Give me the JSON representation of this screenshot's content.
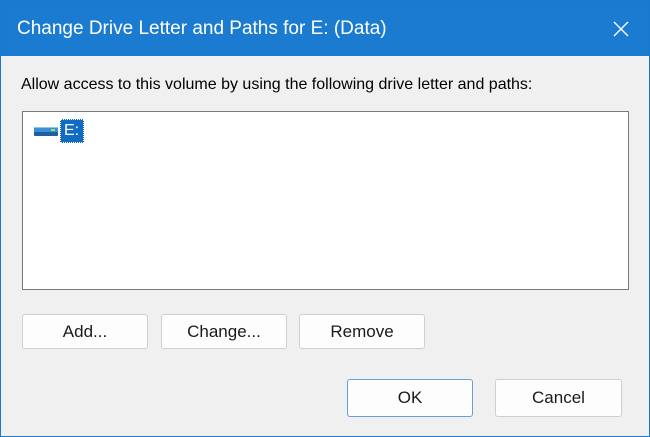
{
  "window": {
    "title": "Change Drive Letter and Paths for E: (Data)",
    "accent_color": "#1b7bd0"
  },
  "titlebar": {
    "close_icon": "close-icon"
  },
  "dialog": {
    "prompt": "Allow access to this volume by using the following drive letter and paths:",
    "list": [
      {
        "label": "E:",
        "icon": "drive-icon",
        "selected": true
      }
    ],
    "buttons": {
      "add": "Add...",
      "change": "Change...",
      "remove": "Remove",
      "ok": "OK",
      "cancel": "Cancel"
    }
  }
}
